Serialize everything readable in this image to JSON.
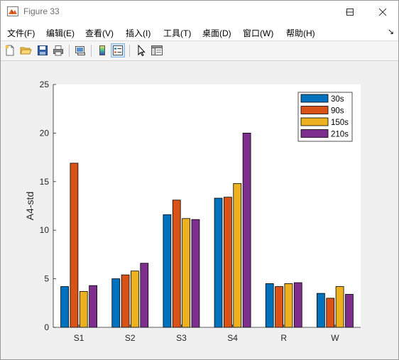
{
  "window": {
    "title": "Figure 33",
    "title_icon": "matlab-figure-icon",
    "controls": [
      "minimize-icon",
      "maximize-icon",
      "close-icon"
    ]
  },
  "menu": {
    "items": [
      "文件(F)",
      "编辑(E)",
      "查看(V)",
      "插入(I)",
      "工具(T)",
      "桌面(D)",
      "窗口(W)",
      "帮助(H)"
    ],
    "overflow_icon": "dock-arrow-icon"
  },
  "toolbar": {
    "buttons": [
      "new-figure-icon",
      "open-file-icon",
      "save-icon",
      "print-icon",
      "link-plot-icon",
      "colorbar-icon",
      "legend-icon",
      "pointer-icon",
      "property-inspector-icon"
    ]
  },
  "chart_data": {
    "type": "bar",
    "categories": [
      "S1",
      "S2",
      "S3",
      "S4",
      "R",
      "W"
    ],
    "series": [
      {
        "name": "30s",
        "color": "#0072BD",
        "values": [
          4.2,
          5.0,
          11.6,
          13.3,
          4.5,
          3.5
        ]
      },
      {
        "name": "90s",
        "color": "#D95319",
        "values": [
          16.9,
          5.4,
          13.1,
          13.4,
          4.2,
          3.0
        ]
      },
      {
        "name": "150s",
        "color": "#EDB120",
        "values": [
          3.7,
          5.8,
          11.2,
          14.8,
          4.5,
          4.2
        ]
      },
      {
        "name": "210s",
        "color": "#7E2F8E",
        "values": [
          4.3,
          6.6,
          11.1,
          20.0,
          4.6,
          3.4
        ]
      }
    ],
    "xlabel": "",
    "ylabel": "A4-std",
    "ylim": [
      0,
      25
    ],
    "yticks": [
      0,
      5,
      10,
      15,
      20,
      25
    ],
    "grid": false,
    "legend_position": "top-right"
  }
}
